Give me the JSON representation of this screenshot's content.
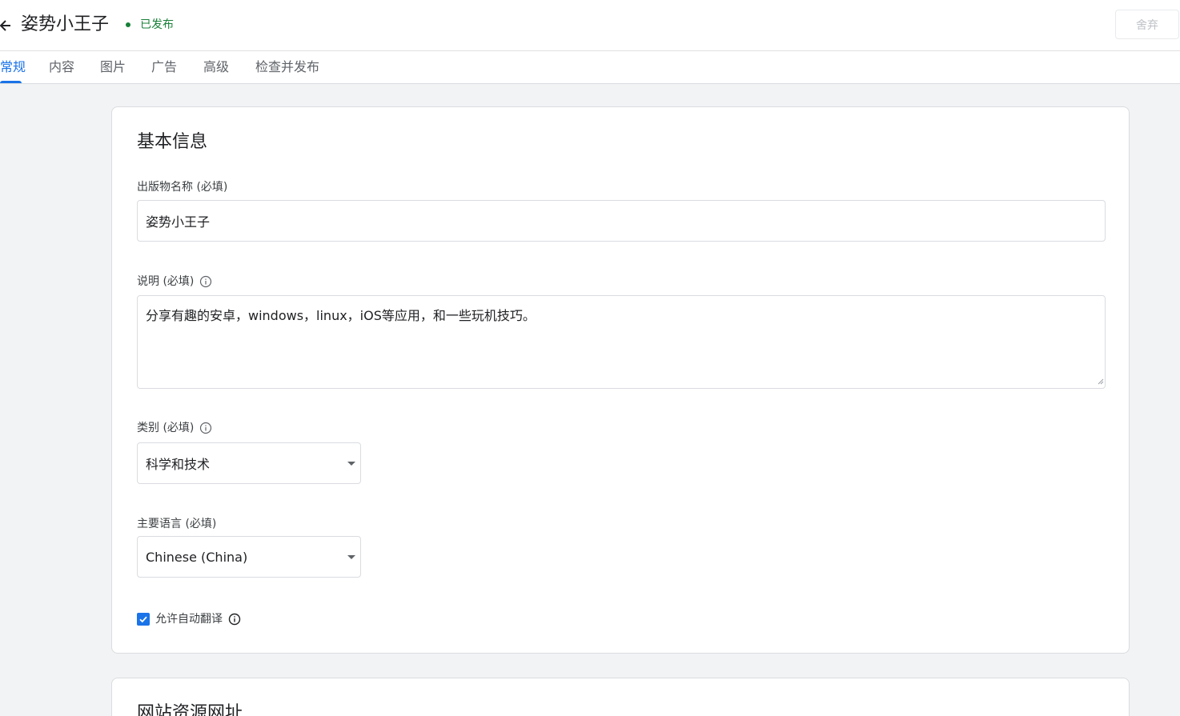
{
  "header": {
    "title": "姿势小王子",
    "status": "已发布",
    "discard_label": "舍弃"
  },
  "tabs": [
    {
      "label": "常规",
      "active": true
    },
    {
      "label": "内容"
    },
    {
      "label": "图片"
    },
    {
      "label": "广告"
    },
    {
      "label": "高级"
    },
    {
      "label": "检查并发布"
    }
  ],
  "basic_info": {
    "title": "基本信息",
    "pub_name": {
      "label": "出版物名称 (必填)",
      "value": "姿势小王子"
    },
    "description": {
      "label": "说明 (必填)",
      "value": "分享有趣的安卓，windows，linux，iOS等应用，和一些玩机技巧。"
    },
    "category": {
      "label": "类别 (必填)",
      "value": "科学和技术"
    },
    "language": {
      "label": "主要语言 (必填)",
      "value": "Chinese (China)"
    },
    "auto_translate": {
      "label": "允许自动翻译",
      "checked": true
    }
  },
  "web_section": {
    "title": "网站资源网址"
  },
  "colors": {
    "accent": "#1a73e8",
    "published": "#188038"
  }
}
